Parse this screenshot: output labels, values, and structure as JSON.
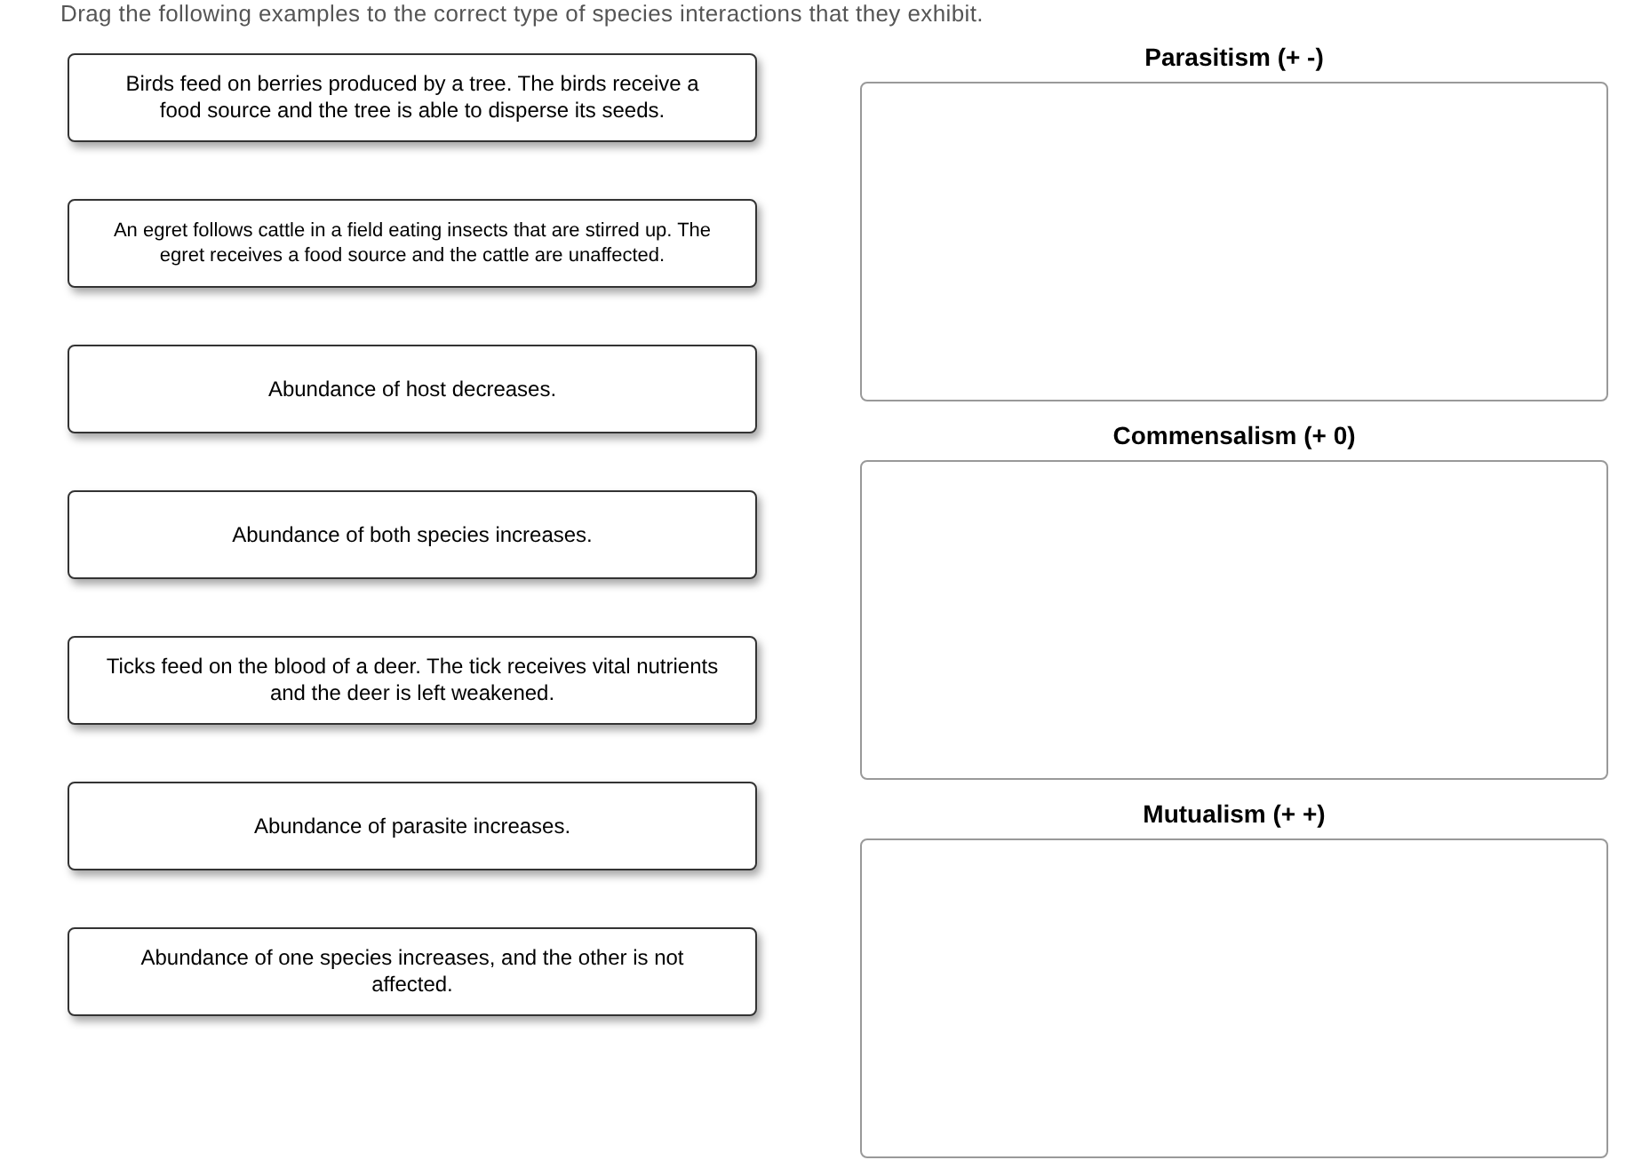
{
  "instruction": "Drag the following examples to the correct type of species interactions that they exhibit.",
  "examples": [
    {
      "text": "Birds feed on berries produced by a tree. The birds receive a food source and the tree is able to disperse its seeds."
    },
    {
      "text": "An egret follows cattle in a field eating insects that are stirred up. The egret receives a food source and the cattle are unaffected."
    },
    {
      "text": "Abundance of host decreases."
    },
    {
      "text": "Abundance of both species increases."
    },
    {
      "text": "Ticks feed on the blood of a deer. The tick receives vital nutrients and the deer is left weakened."
    },
    {
      "text": "Abundance of parasite increases."
    },
    {
      "text": "Abundance of one species increases, and the other is not affected."
    }
  ],
  "targets": [
    {
      "title": "Parasitism (+ -)"
    },
    {
      "title": "Commensalism (+ 0)"
    },
    {
      "title": "Mutualism (+ +)"
    }
  ]
}
